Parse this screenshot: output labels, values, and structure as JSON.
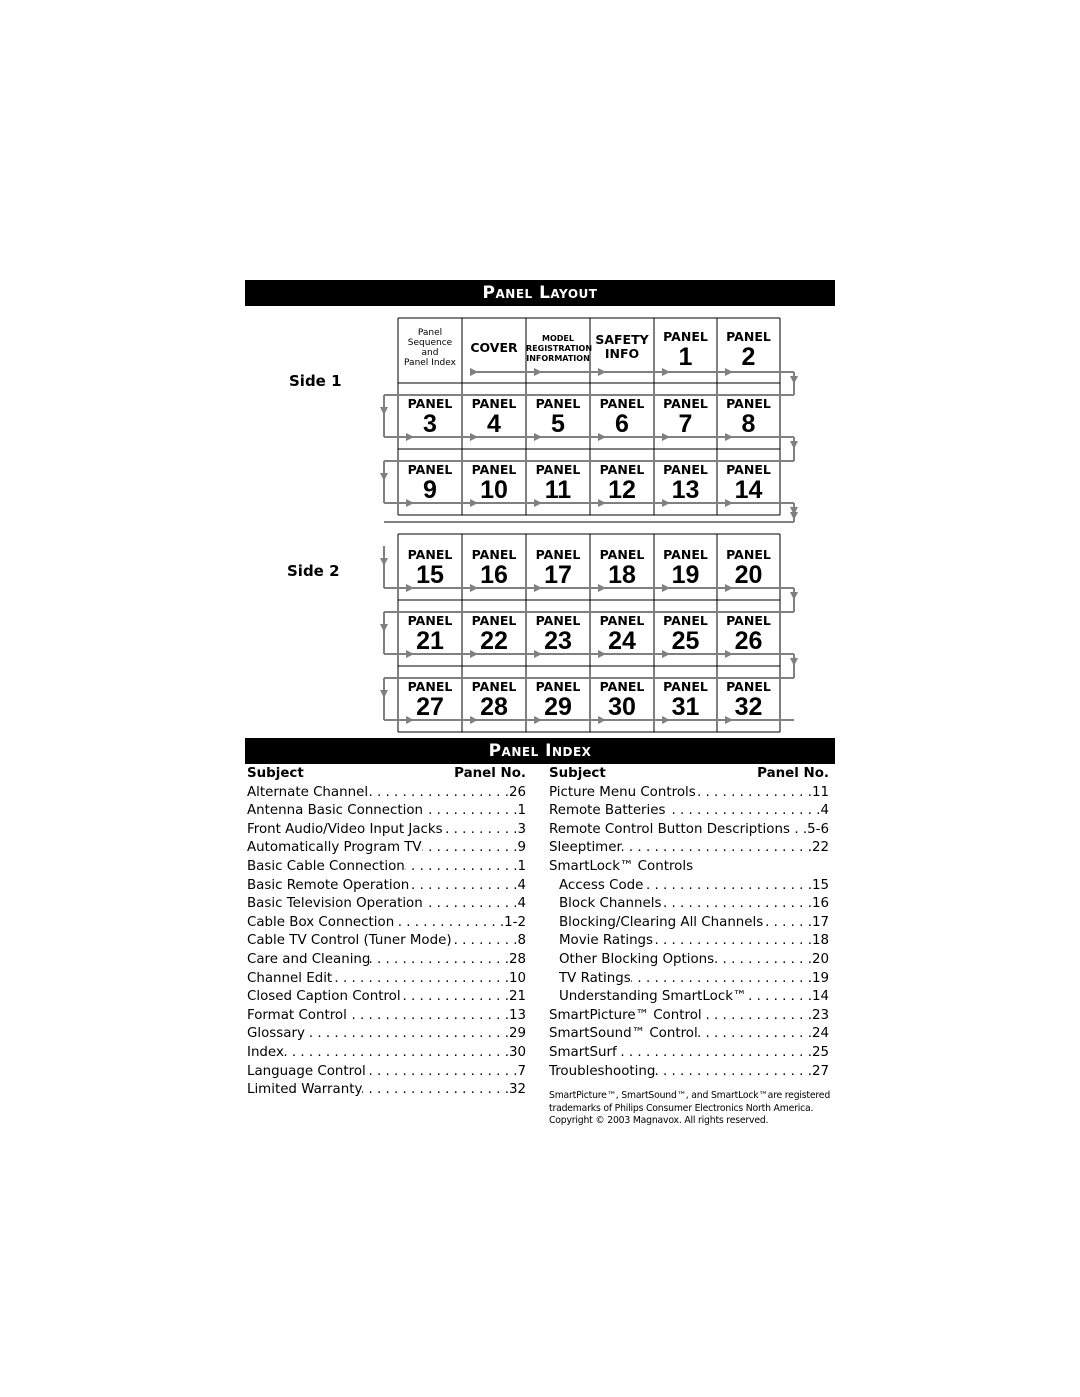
{
  "layout": {
    "title": "Panel Layout",
    "side1": "Side 1",
    "side2": "Side 2",
    "row0": [
      {
        "type": "seq",
        "lines": [
          "Panel",
          "Sequence",
          "and",
          "Panel Index"
        ]
      },
      {
        "type": "word",
        "lines": [
          "COVER"
        ]
      },
      {
        "type": "small",
        "lines": [
          "MODEL",
          "REGISTRATION",
          "INFORMATION"
        ]
      },
      {
        "type": "word",
        "lines": [
          "SAFETY",
          "INFO"
        ]
      },
      {
        "type": "panel",
        "label": "PANEL",
        "num": "1"
      },
      {
        "type": "panel",
        "label": "PANEL",
        "num": "2"
      }
    ],
    "panel_label": "PANEL",
    "panel_numbers": [
      [
        "3",
        "4",
        "5",
        "6",
        "7",
        "8"
      ],
      [
        "9",
        "10",
        "11",
        "12",
        "13",
        "14"
      ],
      [
        "15",
        "16",
        "17",
        "18",
        "19",
        "20"
      ],
      [
        "21",
        "22",
        "23",
        "24",
        "25",
        "26"
      ],
      [
        "27",
        "28",
        "29",
        "30",
        "31",
        "32"
      ]
    ]
  },
  "index": {
    "title": "Panel Index",
    "subject_header": "Subject",
    "panel_header": "Panel No.",
    "left": [
      {
        "s": "Alternate Channel",
        "n": "26"
      },
      {
        "s": "Antenna Basic Connection",
        "n": "1"
      },
      {
        "s": "Front Audio/Video Input Jacks",
        "n": "3"
      },
      {
        "s": "Automatically Program TV",
        "n": "9"
      },
      {
        "s": "Basic Cable Connection",
        "n": "1"
      },
      {
        "s": "Basic Remote Operation",
        "n": "4"
      },
      {
        "s": "Basic Television Operation",
        "n": "4"
      },
      {
        "s": "Cable Box Connection",
        "n": "1-2"
      },
      {
        "s": "Cable TV Control (Tuner Mode)",
        "n": "8"
      },
      {
        "s": "Care and Cleaning",
        "n": "28"
      },
      {
        "s": "Channel Edit",
        "n": "10"
      },
      {
        "s": "Closed Caption Control",
        "n": "21"
      },
      {
        "s": "Format Control",
        "n": "13"
      },
      {
        "s": "Glossary",
        "n": "29"
      },
      {
        "s": "Index",
        "n": "30"
      },
      {
        "s": "Language Control",
        "n": "7"
      },
      {
        "s": "Limited Warranty",
        "n": "32"
      }
    ],
    "right": [
      {
        "s": "Picture Menu Controls",
        "n": "11"
      },
      {
        "s": "Remote Batteries",
        "n": "4"
      },
      {
        "s": "Remote Control Button Descriptions",
        "n": "5-6"
      },
      {
        "s": "Sleeptimer",
        "n": "22"
      },
      {
        "s": "SmartLock™ Controls",
        "n": ""
      },
      {
        "s": "Access Code",
        "n": "15",
        "sub": true
      },
      {
        "s": "Block Channels",
        "n": "16",
        "sub": true
      },
      {
        "s": "Blocking/Clearing All Channels",
        "n": "17",
        "sub": true
      },
      {
        "s": "Movie Ratings",
        "n": "18",
        "sub": true
      },
      {
        "s": "Other Blocking Options",
        "n": "20",
        "sub": true
      },
      {
        "s": "TV Ratings",
        "n": "19",
        "sub": true
      },
      {
        "s": "Understanding SmartLock™",
        "n": "14",
        "sub": true
      },
      {
        "s": "SmartPicture™ Control",
        "n": "23"
      },
      {
        "s": "SmartSound™ Control",
        "n": "24"
      },
      {
        "s": "SmartSurf",
        "n": "25"
      },
      {
        "s": "Troubleshooting",
        "n": "27"
      }
    ],
    "footnote": "SmartPicture™, SmartSound™, and SmartLock™are registered trademarks of Philips Consumer Electronics North America. Copyright © 2003 Magnavox. All rights reserved."
  }
}
